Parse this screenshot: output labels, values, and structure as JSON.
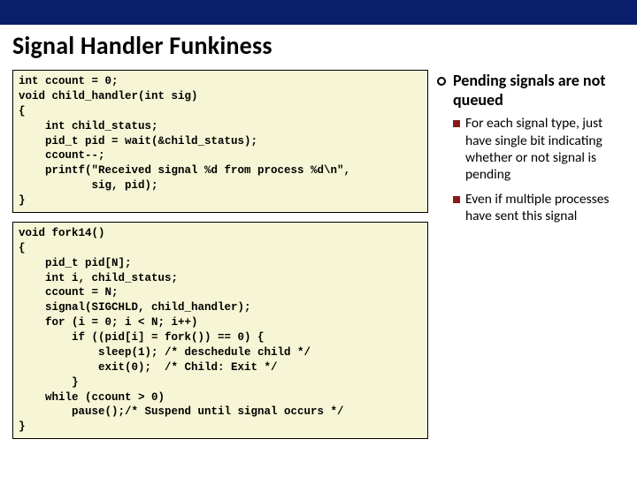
{
  "title": "Signal Handler Funkiness",
  "code1": "int ccount = 0;\nvoid child_handler(int sig)\n{\n    int child_status;\n    pid_t pid = wait(&child_status);\n    ccount--;\n    printf(\"Received signal %d from process %d\\n\",\n           sig, pid);\n}",
  "code2": "void fork14()\n{\n    pid_t pid[N];\n    int i, child_status;\n    ccount = N;\n    signal(SIGCHLD, child_handler);\n    for (i = 0; i < N; i++)\n        if ((pid[i] = fork()) == 0) {\n            sleep(1); /* deschedule child */\n            exit(0);  /* Child: Exit */\n        }\n    while (ccount > 0)\n        pause();/* Suspend until signal occurs */\n}",
  "bullets": {
    "main": "Pending signals are not queued",
    "sub1": "For each signal type, just have single bit indicating whether or not signal is pending",
    "sub2": "Even if multiple processes have sent this signal"
  }
}
